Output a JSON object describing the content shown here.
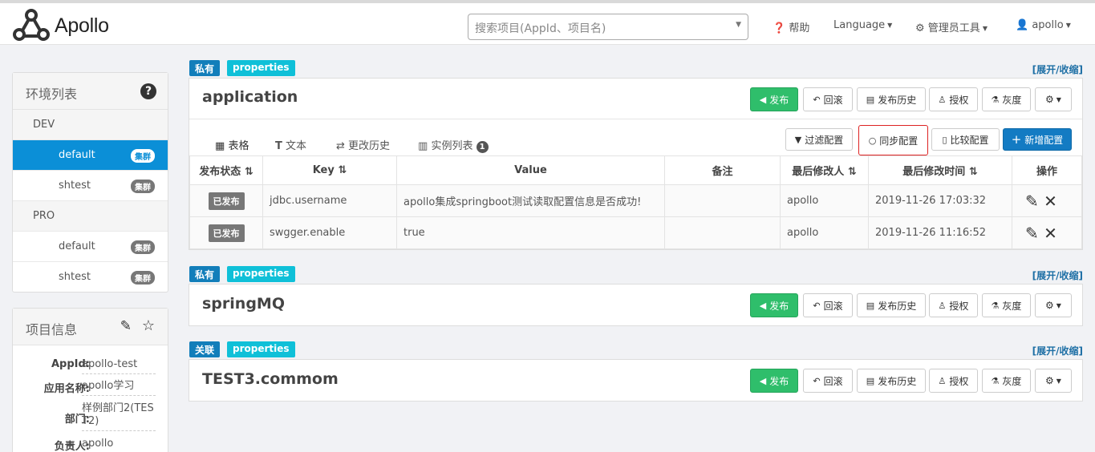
{
  "nav": {
    "logo": "Apollo",
    "search_placeholder": "搜索项目(AppId、项目名)",
    "help": "帮助",
    "language": "Language",
    "admin": "管理员工具",
    "user": "apollo"
  },
  "env_panel": {
    "title": "环境列表",
    "items": [
      {
        "label": "DEV",
        "type": "env"
      },
      {
        "label": "default",
        "type": "cluster",
        "badge": "集群"
      },
      {
        "label": "shtest",
        "type": "cluster",
        "badge": "集群"
      },
      {
        "label": "PRO",
        "type": "env"
      },
      {
        "label": "default",
        "type": "cluster",
        "badge": "集群"
      },
      {
        "label": "shtest",
        "type": "cluster",
        "badge": "集群"
      }
    ]
  },
  "project_panel": {
    "title": "项目信息",
    "rows": [
      {
        "key": "AppId:",
        "value": "apollo-test"
      },
      {
        "key": "应用名称:",
        "value": "apollo学习"
      },
      {
        "key": "部门:",
        "value": "样例部门2(TEST2)"
      },
      {
        "key": "负责人:",
        "value": "apollo"
      }
    ]
  },
  "buttons": {
    "publish": "发布",
    "rollback": "回滚",
    "history": "发布历史",
    "grant": "授权",
    "gray": "灰度",
    "filter": "过滤配置",
    "sync": "同步配置",
    "compare": "比较配置",
    "add": "新增配置"
  },
  "toggle": "[展开/收缩]",
  "namespaces": [
    {
      "scope": "私有",
      "format": "properties",
      "name": "application"
    },
    {
      "scope": "私有",
      "format": "properties",
      "name": "springMQ"
    },
    {
      "scope": "关联",
      "format": "properties",
      "name": "TEST3.commom"
    }
  ],
  "tabs": {
    "table": "表格",
    "text": "文本",
    "history": "更改历史",
    "instances": "实例列表",
    "instance_count": "1"
  },
  "table": {
    "headers": [
      "发布状态",
      "Key",
      "Value",
      "备注",
      "最后修改人",
      "最后修改时间",
      "操作"
    ],
    "rows": [
      {
        "status": "已发布",
        "key": "jdbc.username",
        "value": "apollo集成springboot测试读取配置信息是否成功!",
        "comment": "",
        "modifier": "apollo",
        "time": "2019-11-26 17:03:32"
      },
      {
        "status": "已发布",
        "key": "swgger.enable",
        "value": "true",
        "comment": "",
        "modifier": "apollo",
        "time": "2019-11-26 11:16:52"
      }
    ]
  }
}
